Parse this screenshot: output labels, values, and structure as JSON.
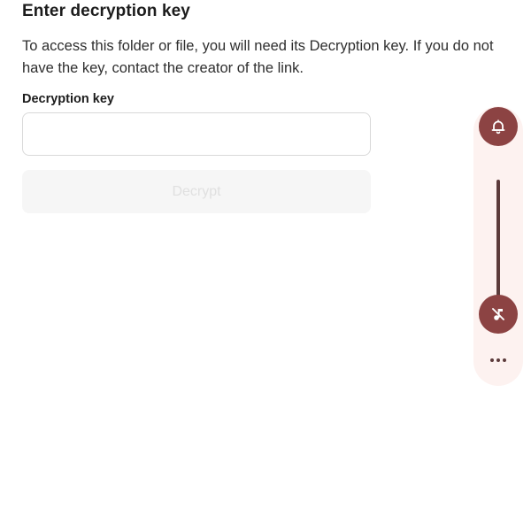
{
  "dialog": {
    "title": "Enter decryption key",
    "description": "To access this folder or file, you will need its Decryption key. If you do not have the key, contact the creator of the link.",
    "field_label": "Decryption key",
    "input_value": "",
    "input_placeholder": "",
    "button_label": "Decrypt",
    "button_state": "disabled"
  },
  "volume_panel": {
    "icons": [
      "bell-icon",
      "music-note-off-icon",
      "more-dots-icon"
    ],
    "accent_color": "#8c4343",
    "background_color": "#fdf2f0"
  }
}
